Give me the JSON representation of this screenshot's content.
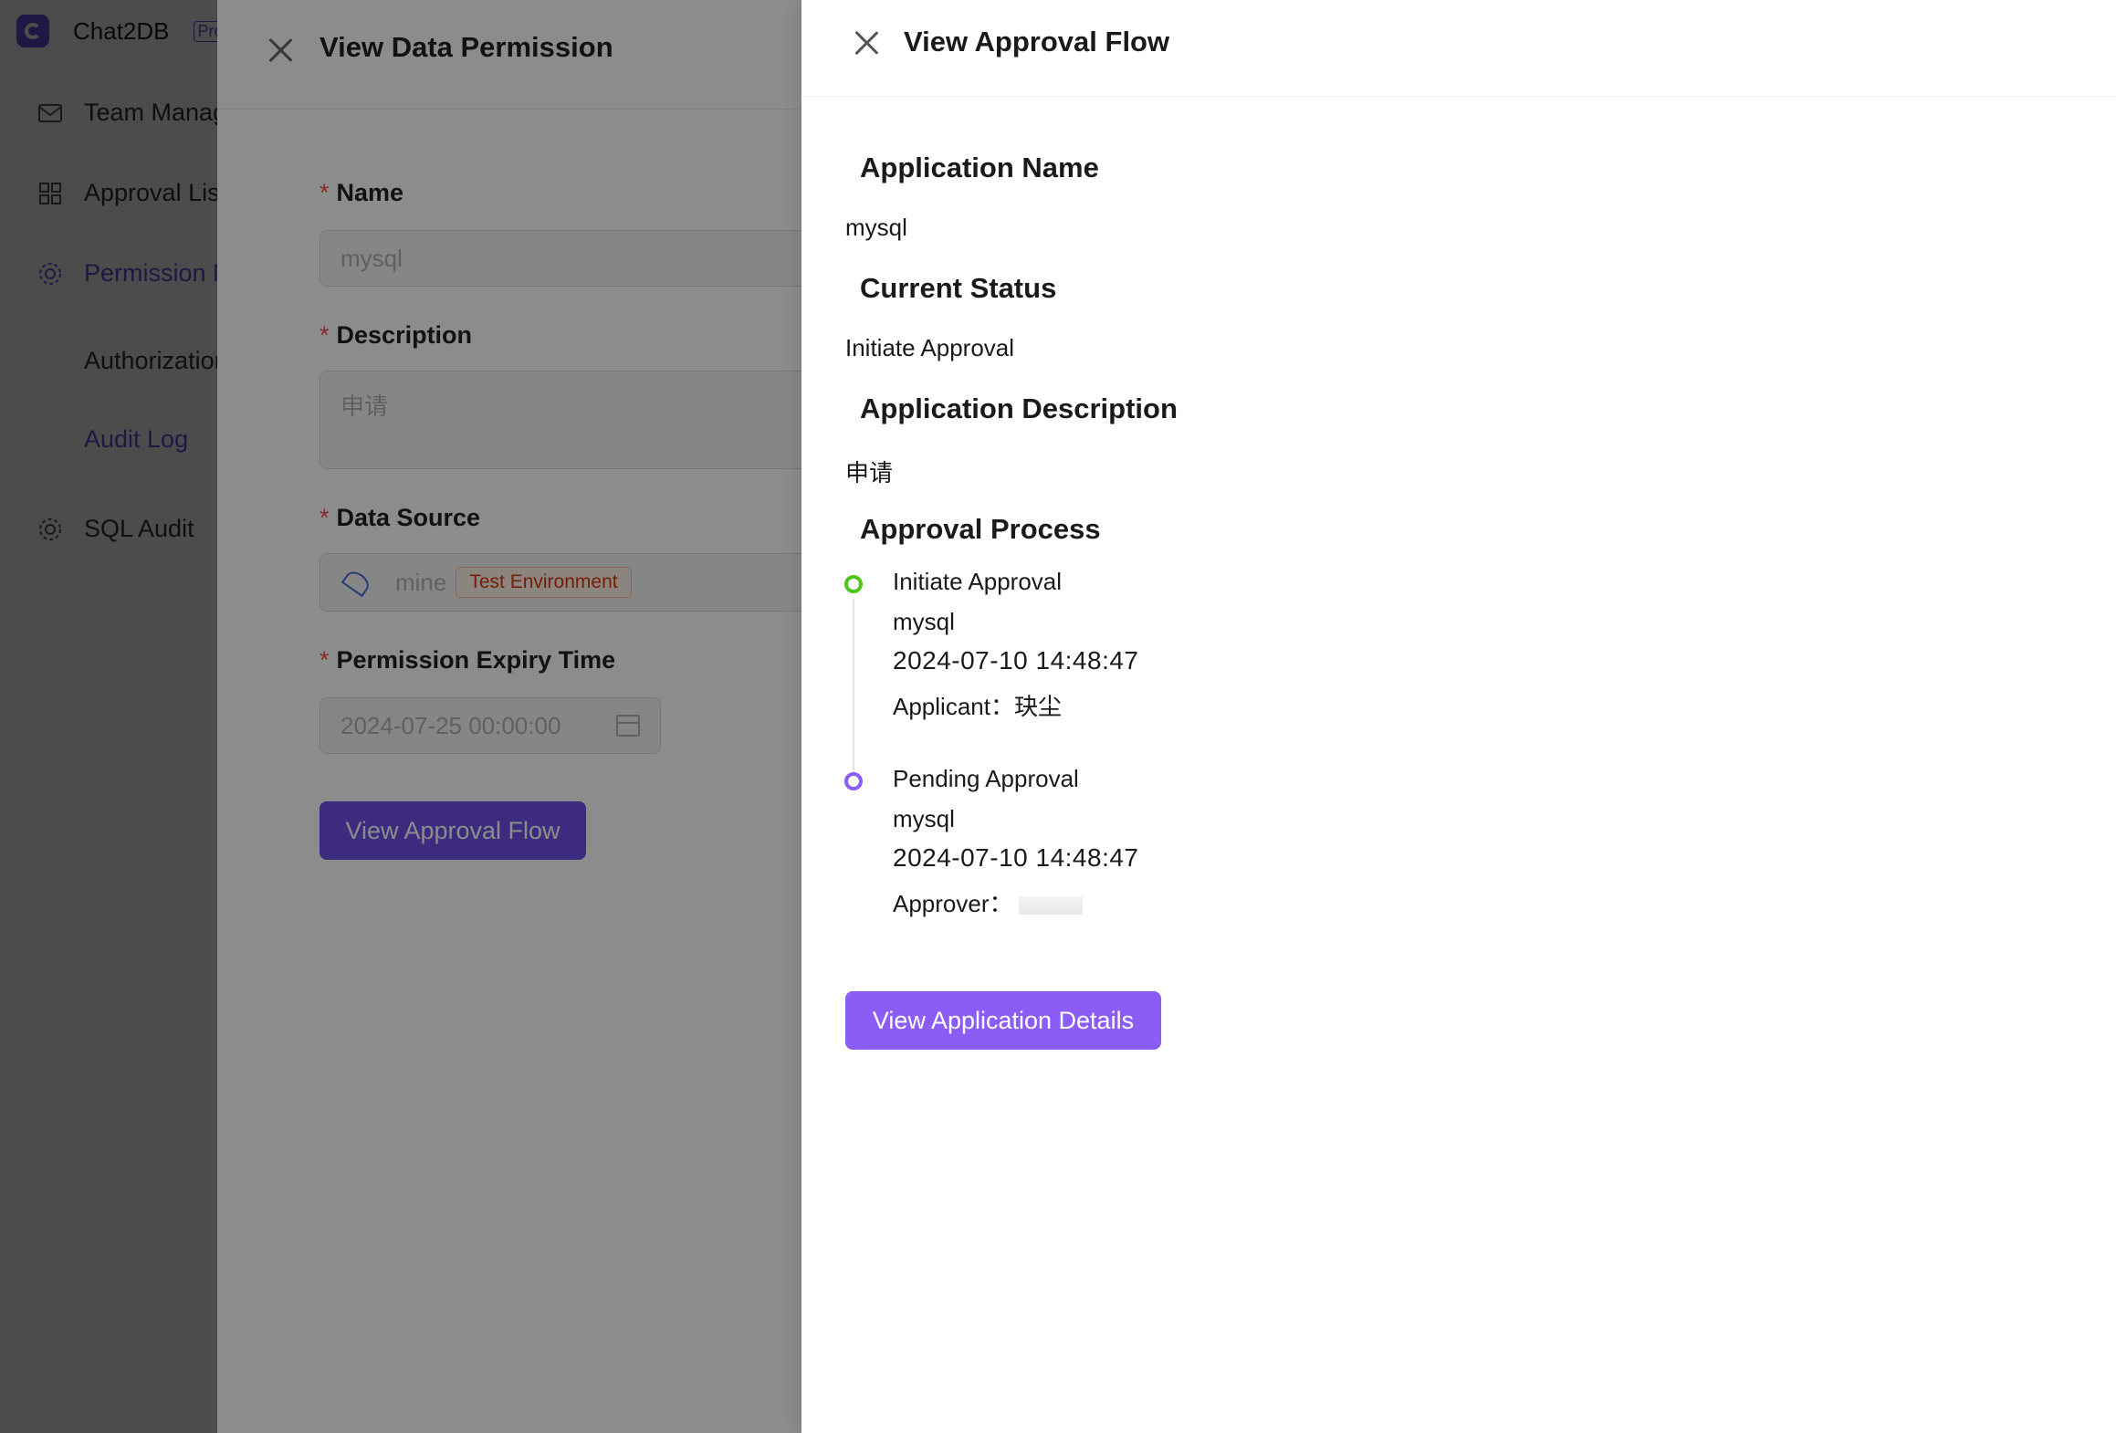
{
  "sidebar": {
    "brand_name": "Chat2DB",
    "brand_badge": "Pro",
    "items": [
      {
        "label": "Team Management"
      },
      {
        "label": "Approval List"
      },
      {
        "label": "Permission Management"
      },
      {
        "label": "Authorization"
      },
      {
        "label": "Audit Log"
      },
      {
        "label": "SQL Audit"
      }
    ]
  },
  "permission_drawer": {
    "title": "View Data Permission",
    "name_label": "Name",
    "name_value": "mysql",
    "description_label": "Description",
    "description_value": "申请",
    "data_source_label": "Data Source",
    "data_source_value": "mine",
    "data_source_tag": "Test Environment",
    "expiry_label": "Permission Expiry Time",
    "expiry_value": "2024-07-25 00:00:00",
    "view_flow_button": "View Approval Flow"
  },
  "approval_drawer": {
    "title": "View Approval Flow",
    "application_name_label": "Application Name",
    "application_name": "mysql",
    "current_status_label": "Current Status",
    "current_status": "Initiate Approval",
    "description_label": "Application Description",
    "description": "申请",
    "process_label": "Approval Process",
    "steps": [
      {
        "status": "Initiate Approval",
        "name": "mysql",
        "time": "2024-07-10 14:48:47",
        "person_label": "Applicant：",
        "person": "玦尘"
      },
      {
        "status": "Pending Approval",
        "name": "mysql",
        "time": "2024-07-10 14:48:47",
        "person_label": "Approver："
      }
    ],
    "details_button": "View Application Details"
  },
  "colors": {
    "primary": "#8b5cf6",
    "primary_dark": "#6d4fe6",
    "success": "#52c41a",
    "required": "#ff4d4f"
  }
}
